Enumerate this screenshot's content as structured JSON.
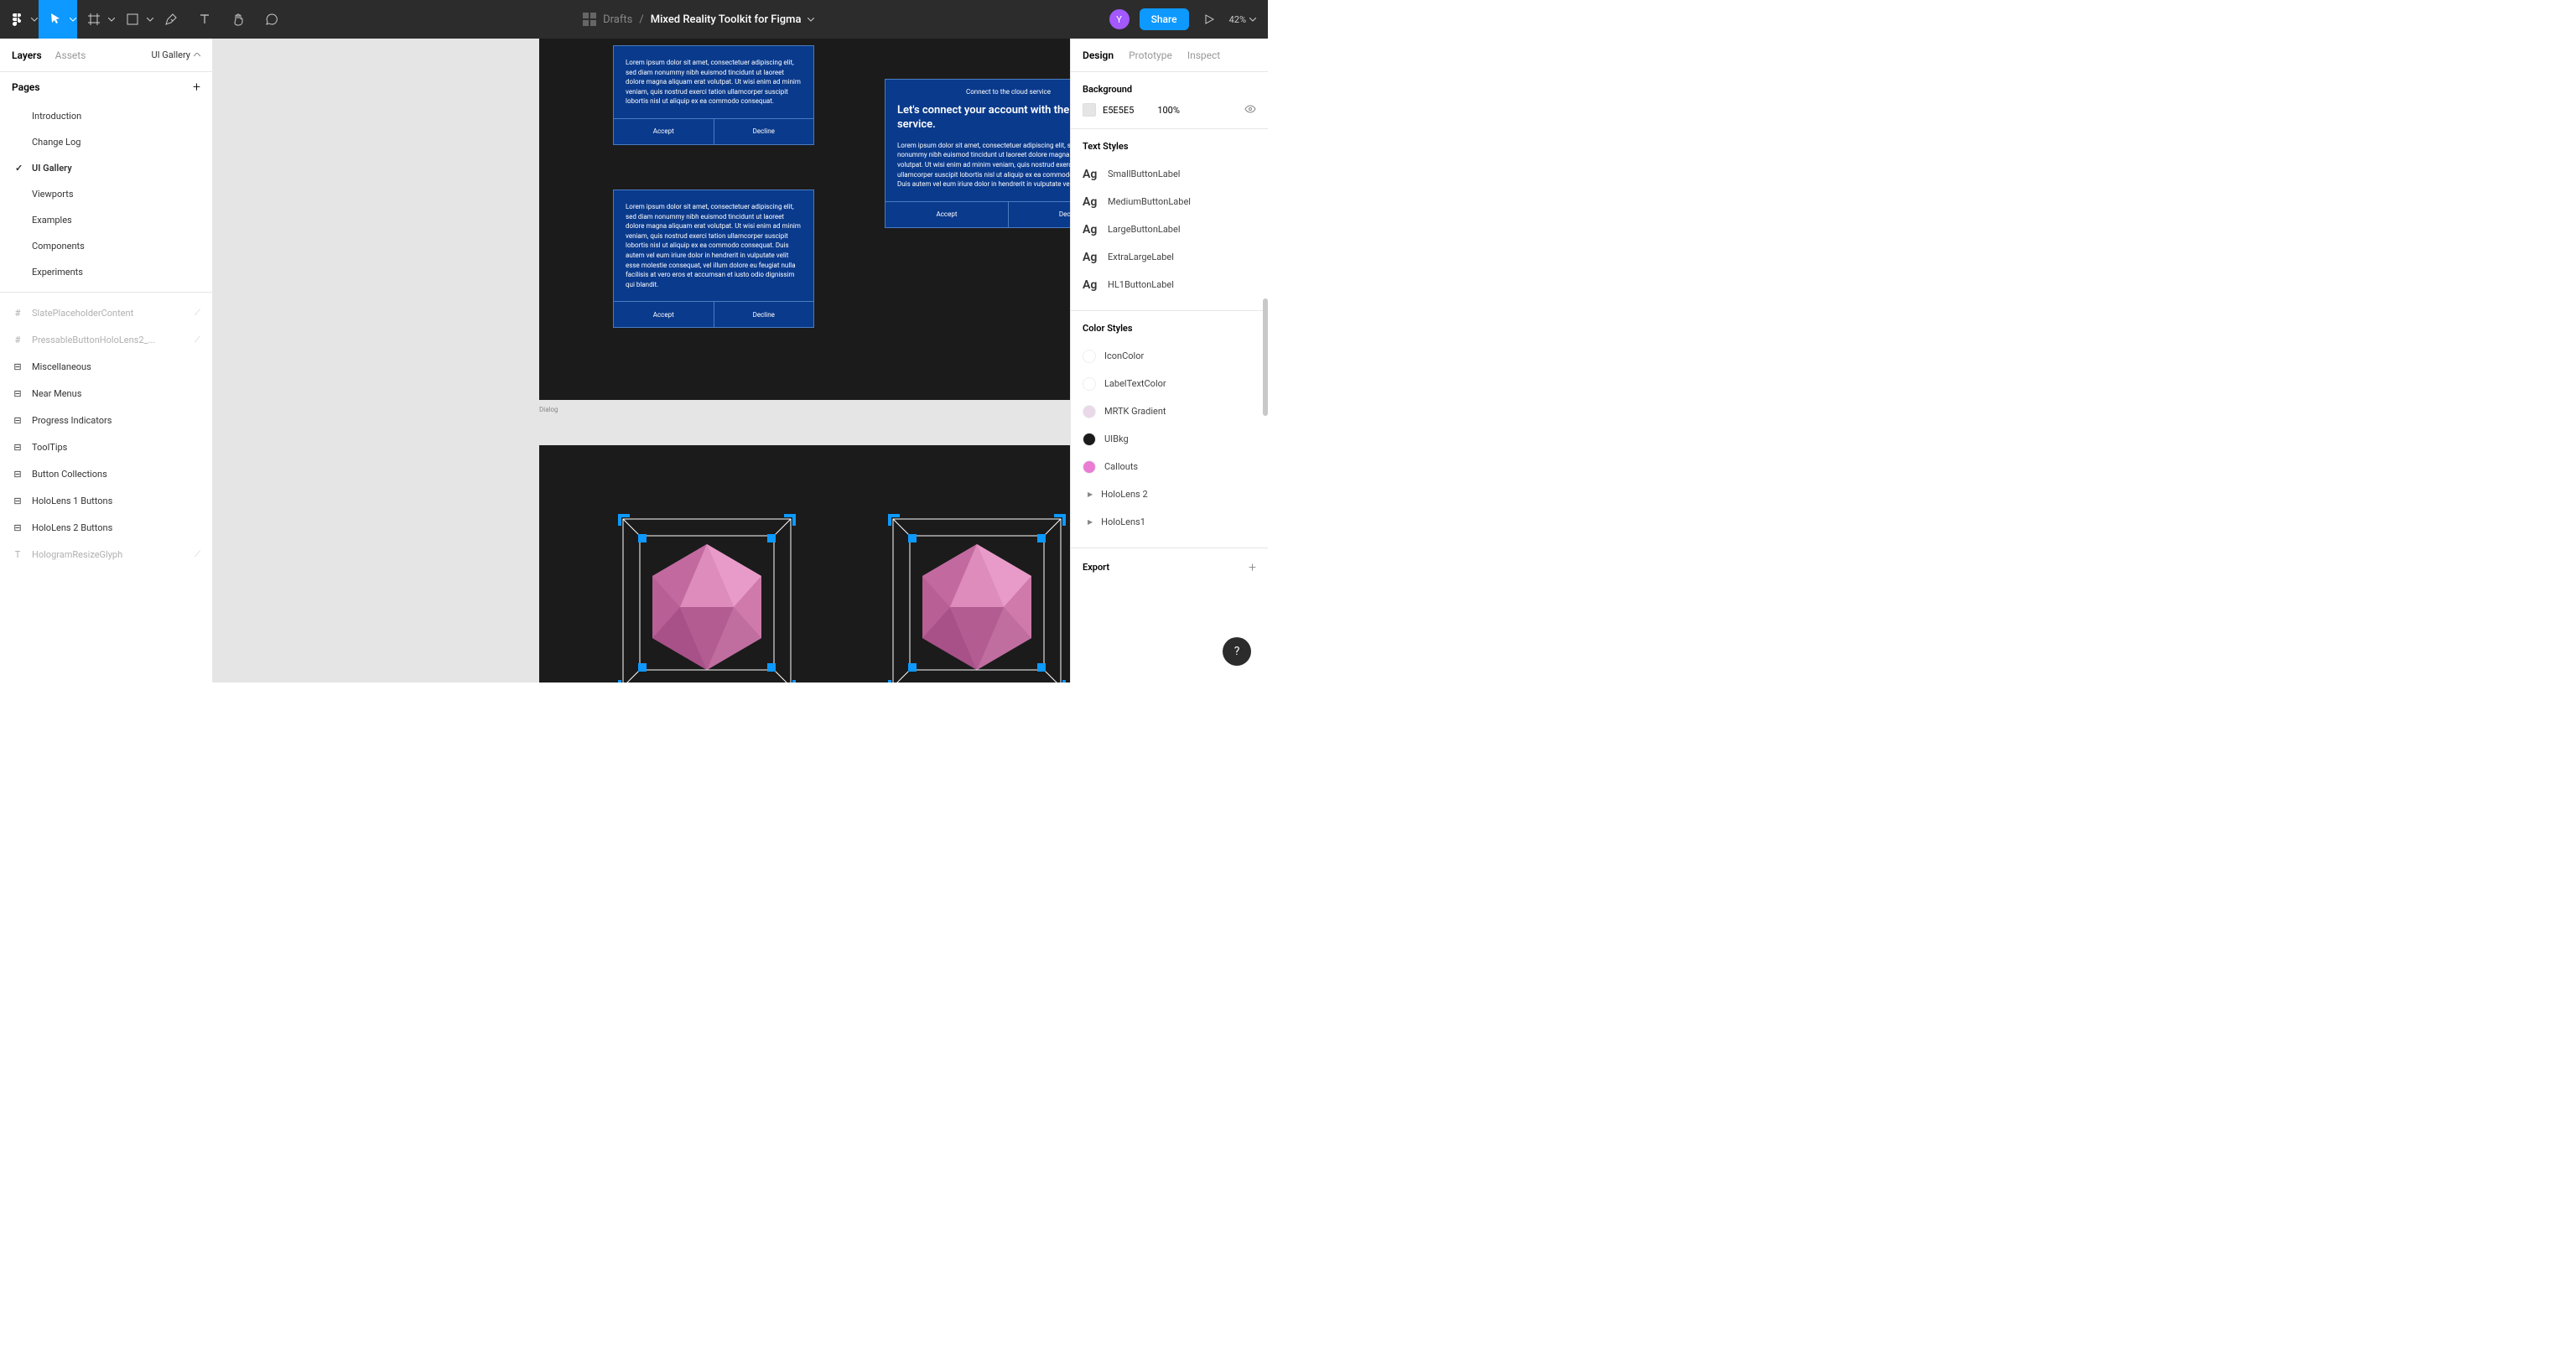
{
  "toolbar": {
    "title_muted": "Drafts",
    "title_sep": "/",
    "title_bold": "Mixed Reality Toolkit for Figma",
    "avatar_letter": "Y",
    "share_label": "Share",
    "zoom": "42%"
  },
  "left_panel": {
    "tabs": [
      "Layers",
      "Assets"
    ],
    "active_tab": 0,
    "page_picker": "UI Gallery",
    "pages_header": "Pages",
    "pages": [
      "Introduction",
      "Change Log",
      "UI Gallery",
      "Viewports",
      "Examples",
      "Components",
      "Experiments"
    ],
    "active_page": 2,
    "layers": [
      {
        "icon": "frame",
        "label": "SlatePlaceholderContent",
        "faded": true,
        "hidden": true
      },
      {
        "icon": "frame",
        "label": "PressableButtonHoloLens2_...",
        "faded": true,
        "hidden": true
      },
      {
        "icon": "group",
        "label": "Miscellaneous",
        "faded": false
      },
      {
        "icon": "group",
        "label": "Near Menus",
        "faded": false
      },
      {
        "icon": "group",
        "label": "Progress Indicators",
        "faded": false
      },
      {
        "icon": "group",
        "label": "ToolTips",
        "faded": false
      },
      {
        "icon": "group",
        "label": "Button Collections",
        "faded": false
      },
      {
        "icon": "group",
        "label": "HoloLens 1 Buttons",
        "faded": false
      },
      {
        "icon": "group",
        "label": "HoloLens 2 Buttons",
        "faded": false
      },
      {
        "icon": "text",
        "label": "HologramResizeGlyph",
        "faded": true,
        "hidden": true
      }
    ]
  },
  "right_panel": {
    "tabs": [
      "Design",
      "Prototype",
      "Inspect"
    ],
    "active_tab": 0,
    "background_header": "Background",
    "background_hex": "E5E5E5",
    "background_opacity": "100%",
    "text_styles_header": "Text Styles",
    "text_styles": [
      "SmallButtonLabel",
      "MediumButtonLabel",
      "LargeButtonLabel",
      "ExtraLargeLabel",
      "HL1ButtonLabel"
    ],
    "color_styles_header": "Color Styles",
    "color_styles": [
      {
        "name": "IconColor",
        "hex": "#ffffff"
      },
      {
        "name": "LabelTextColor",
        "hex": "#ffffff"
      },
      {
        "name": "MRTK Gradient",
        "hex": "#e8d8e8"
      },
      {
        "name": "UIBkg",
        "hex": "#1b1b1b"
      },
      {
        "name": "Callouts",
        "hex": "#ea7cd4"
      }
    ],
    "color_groups": [
      "HoloLens 2",
      "HoloLens1"
    ],
    "export_header": "Export"
  },
  "canvas": {
    "frame_label": "Dialog",
    "lorem1": "Lorem ipsum dolor sit amet, consectetuer adipiscing elit, sed diam nonummy nibh euismod tincidunt ut laoreet dolore magna aliquam erat volutpat. Ut wisi enim ad minim veniam, quis nostrud exerci tation ullamcorper suscipit lobortis nisl ut aliquip ex ea commodo consequat.",
    "lorem2": "Lorem ipsum dolor sit amet, consectetuer adipiscing elit, sed diam nonummy nibh euismod tincidunt ut laoreet dolore magna aliquam erat volutpat. Ut wisi enim ad minim veniam, quis nostrud exerci tation ullamcorper suscipit lobortis nisl ut aliquip ex ea commodo consequat. Duis autem vel eum iriure dolor in hendrerit in vulputate velit esse molestie consequat, vel illum dolore eu feugiat nulla facilisis at vero eros et accumsan et iusto odio dignissim qui blandit.",
    "d3_header": "Connect to the cloud service",
    "d3_title": "Let's connect your account with the cloud service.",
    "d3_body": "Lorem ipsum dolor sit amet, consectetuer adipiscing elit, sed diam nonummy nibh euismod tincidunt ut laoreet dolore magna aliquam erat volutpat. Ut wisi enim ad minim veniam, quis nostrud exerci tation ullamcorper suscipit lobortis nisl ut aliquip ex ea commodo consequat. Duis autem vel eum iriure dolor in hendrerit in vulputate velit.",
    "accept": "Accept",
    "decline": "Decline"
  }
}
